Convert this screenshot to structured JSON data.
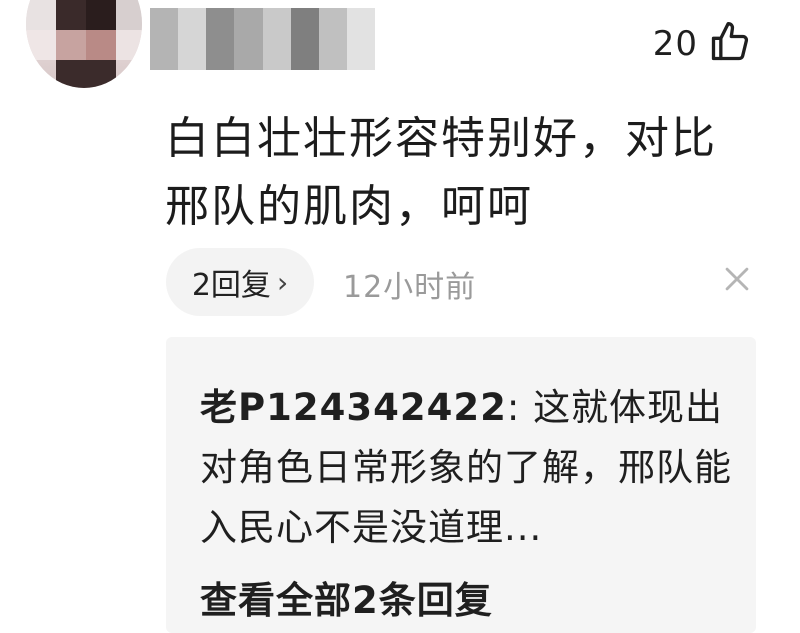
{
  "comment": {
    "likes": "20",
    "text": "白白壮壮形容特别好，对比邢队的肌肉，呵呵",
    "reply_button": "2回复",
    "time": "12小时前"
  },
  "reply_preview": {
    "author": "老P124342422",
    "separator": ": ",
    "text": "这就体现出对角色日常形象的了解，邢队能入民心不是没道理...",
    "view_all": "查看全部2条回复"
  },
  "icons": {
    "like": "thumbs-up-icon",
    "reply_chevron": "chevron-right-icon",
    "close": "close-icon"
  }
}
